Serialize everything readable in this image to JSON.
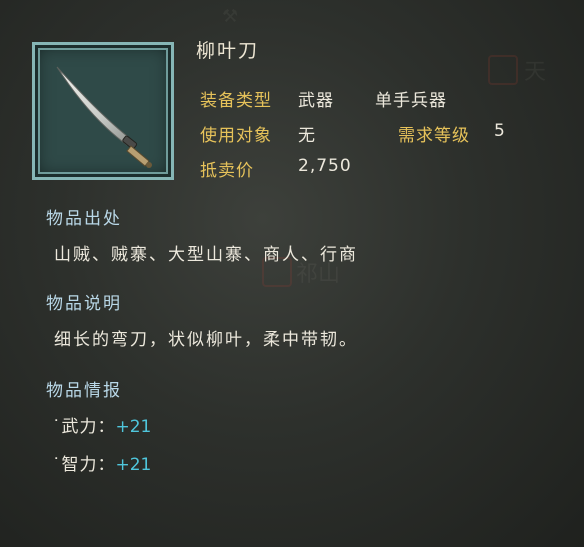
{
  "item": {
    "name": "柳叶刀",
    "icon": "curved-saber-icon"
  },
  "attributes": {
    "type_label": "装备类型",
    "type_value": "武器",
    "subtype_value": "单手兵器",
    "target_label": "使用对象",
    "target_value": "无",
    "level_label": "需求等级",
    "level_value": "5",
    "price_label": "抵卖价",
    "price_value": "2,750"
  },
  "source": {
    "title": "物品出处",
    "text": "山贼、贼寨、大型山寨、商人、行商"
  },
  "description": {
    "title": "物品说明",
    "text": "细长的弯刀，状似柳叶，柔中带韧。"
  },
  "info": {
    "title": "物品情报",
    "stats": [
      {
        "label": "武力：",
        "value": "+21"
      },
      {
        "label": "智力：",
        "value": "+21"
      }
    ]
  },
  "colors": {
    "label_gold": "#e6c25a",
    "section_blue": "#b9d8e8",
    "bonus_cyan": "#4fc6dc",
    "text_light": "#ece8dc",
    "frame_teal": "#86b6b6"
  }
}
